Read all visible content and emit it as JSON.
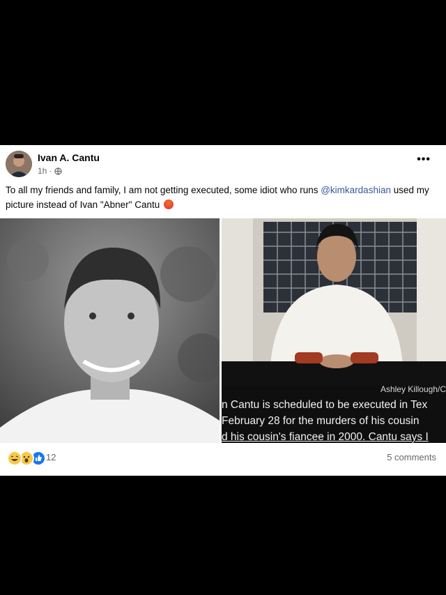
{
  "post": {
    "author": "Ivan A. Cantu",
    "time": "1h ·",
    "more_label": "•••",
    "text_before": "To all my friends and family, I am not getting executed, some idiot who runs ",
    "mention": "@kimkardashian",
    "text_after": " used my picture instead of Ivan \"Abner\" Cantu ",
    "emoji": "angry-face-emoji",
    "accent_color": "#385898"
  },
  "photos": {
    "left": {
      "description_icon": "portrait-photo"
    },
    "right": {
      "credit": "Ashley Killough/C",
      "caption_lines": [
        "n Cantu is scheduled to be executed in Tex",
        "February 28 for the murders of his cousin",
        "d his cousin's fiancee in 2000. Cantu says I"
      ]
    }
  },
  "footer": {
    "reactions": [
      "haha-icon",
      "wow-icon",
      "like-icon"
    ],
    "reaction_count": "12",
    "comments": "5 comments"
  }
}
